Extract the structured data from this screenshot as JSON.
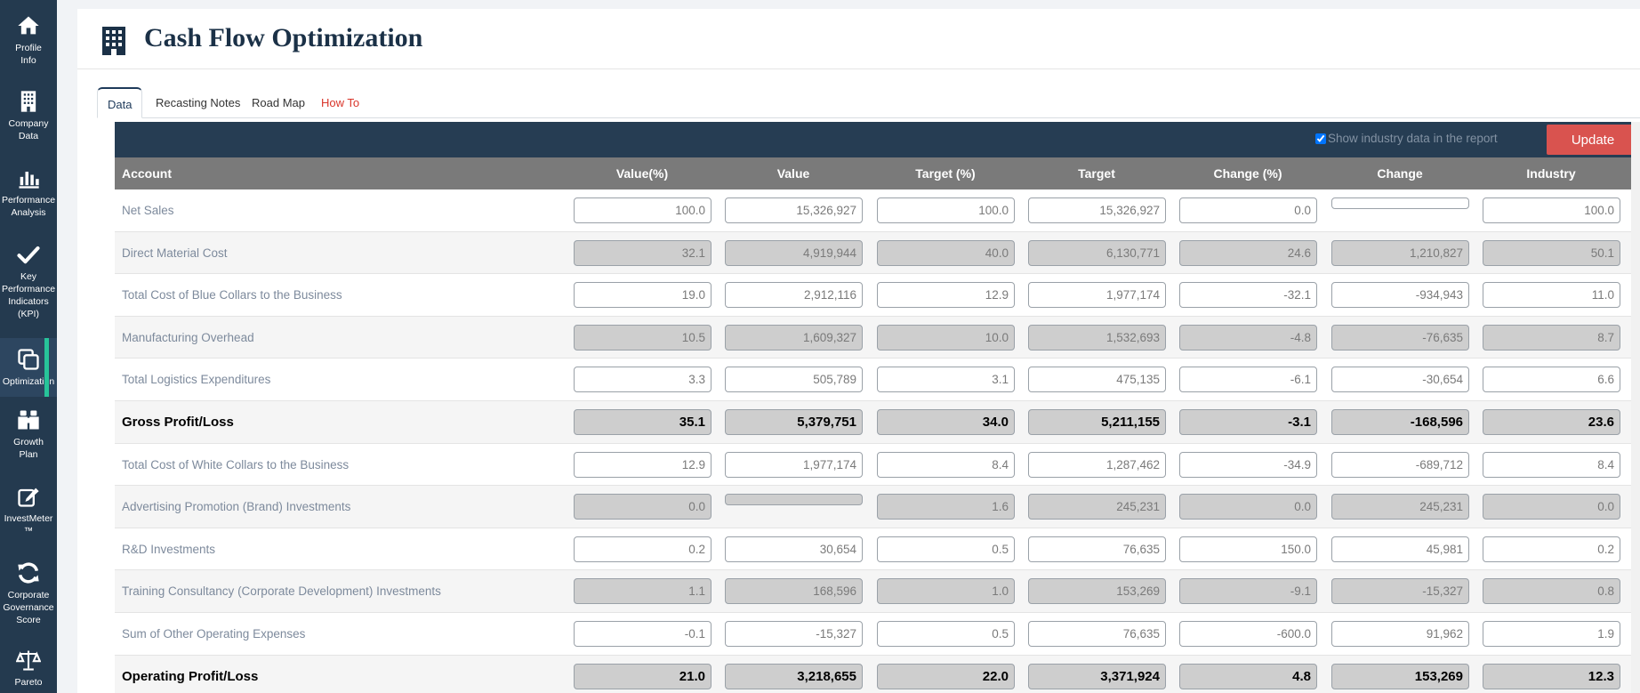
{
  "sidebar": {
    "items": [
      {
        "label": "Profile\nInfo",
        "icon": "home-icon"
      },
      {
        "label": "Company\nData",
        "icon": "building-icon"
      },
      {
        "label": "Performance\nAnalysis",
        "icon": "bar-chart-icon"
      },
      {
        "label": "Key\nPerformance\nIndicators\n(KPI)",
        "icon": "check-icon"
      },
      {
        "label": "Optimization",
        "icon": "copy-icon",
        "active": true
      },
      {
        "label": "Growth\nPlan",
        "icon": "binoculars-icon"
      },
      {
        "label": "InvestMeter\n™",
        "icon": "edit-icon"
      },
      {
        "label": "Corporate\nGovernance\nScore",
        "icon": "refresh-icon"
      },
      {
        "label": "Pareto",
        "icon": "scale-icon"
      }
    ]
  },
  "page": {
    "title": "Cash Flow Optimization"
  },
  "tabs": [
    {
      "label": "Data",
      "active": true
    },
    {
      "label": "Recasting Notes"
    },
    {
      "label": "Road Map"
    },
    {
      "label": "How To",
      "accent": "#d9362b"
    }
  ],
  "toolbar": {
    "show_industry_label": "Show industry data in the report",
    "show_industry_checked": true,
    "update_label": "Update"
  },
  "table": {
    "columns": [
      "Account",
      "Value(%)",
      "Value",
      "Target (%)",
      "Target",
      "Change (%)",
      "Change",
      "Industry"
    ],
    "rows": [
      {
        "account": "Net Sales",
        "bold": false,
        "cells": [
          "100.0",
          "15,326,927",
          "100.0",
          "15,326,927",
          "0.0",
          "",
          "100.0"
        ]
      },
      {
        "account": "Direct Material Cost",
        "bold": false,
        "cells": [
          "32.1",
          "4,919,944",
          "40.0",
          "6,130,771",
          "24.6",
          "1,210,827",
          "50.1"
        ]
      },
      {
        "account": "Total Cost of Blue Collars to the Business",
        "bold": false,
        "cells": [
          "19.0",
          "2,912,116",
          "12.9",
          "1,977,174",
          "-32.1",
          "-934,943",
          "11.0"
        ]
      },
      {
        "account": "Manufacturing Overhead",
        "bold": false,
        "cells": [
          "10.5",
          "1,609,327",
          "10.0",
          "1,532,693",
          "-4.8",
          "-76,635",
          "8.7"
        ]
      },
      {
        "account": "Total Logistics Expenditures",
        "bold": false,
        "cells": [
          "3.3",
          "505,789",
          "3.1",
          "475,135",
          "-6.1",
          "-30,654",
          "6.6"
        ]
      },
      {
        "account": "Gross Profit/Loss",
        "bold": true,
        "cells": [
          "35.1",
          "5,379,751",
          "34.0",
          "5,211,155",
          "-3.1",
          "-168,596",
          "23.6"
        ]
      },
      {
        "account": "Total Cost of White Collars to the Business",
        "bold": false,
        "cells": [
          "12.9",
          "1,977,174",
          "8.4",
          "1,287,462",
          "-34.9",
          "-689,712",
          "8.4"
        ]
      },
      {
        "account": "Advertising Promotion (Brand) Investments",
        "bold": false,
        "cells": [
          "0.0",
          "",
          "1.6",
          "245,231",
          "0.0",
          "245,231",
          "0.0"
        ]
      },
      {
        "account": "R&D Investments",
        "bold": false,
        "cells": [
          "0.2",
          "30,654",
          "0.5",
          "76,635",
          "150.0",
          "45,981",
          "0.2"
        ]
      },
      {
        "account": "Training Consultancy (Corporate Development) Investments",
        "bold": false,
        "cells": [
          "1.1",
          "168,596",
          "1.0",
          "153,269",
          "-9.1",
          "-15,327",
          "0.8"
        ]
      },
      {
        "account": "Sum of Other Operating Expenses",
        "bold": false,
        "cells": [
          "-0.1",
          "-15,327",
          "0.5",
          "76,635",
          "-600.0",
          "91,962",
          "1.9"
        ]
      },
      {
        "account": "Operating Profit/Loss",
        "bold": true,
        "cells": [
          "21.0",
          "3,218,655",
          "22.0",
          "3,371,924",
          "4.8",
          "153,269",
          "12.3"
        ]
      }
    ]
  },
  "colors": {
    "sidebar_bg": "#243a4f",
    "active_accent": "#27c49a",
    "header_bar": "#263d53",
    "column_header": "#7a7a7a",
    "update_button": "#d9534f"
  }
}
